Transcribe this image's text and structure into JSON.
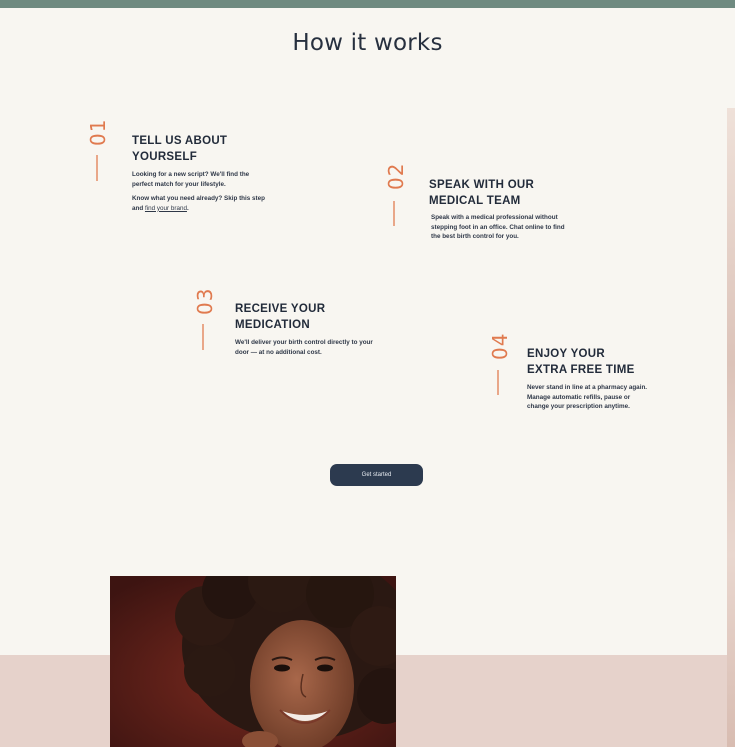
{
  "title": "How it works",
  "steps": [
    {
      "number": "01",
      "title": "TELL US ABOUT YOURSELF",
      "desc1": "Looking for a new script? We'll find the perfect match for your lifestyle.",
      "desc2_prefix": "Know what you need already? Skip this step and ",
      "desc2_link": "find your brand",
      "desc2_suffix": "."
    },
    {
      "number": "02",
      "title": "SPEAK WITH OUR MEDICAL TEAM",
      "desc1": "Speak with a medical professional without stepping foot in an office. Chat online to find the best birth control for you."
    },
    {
      "number": "03",
      "title": "RECEIVE YOUR MEDICATION",
      "desc1": "We'll deliver your birth control directly to your door — at no additional cost."
    },
    {
      "number": "04",
      "title": "ENJOY YOUR EXTRA FREE TIME",
      "desc1": "Never stand in line at a pharmacy again. Manage automatic refills, pause or change your prescription anytime."
    }
  ],
  "cta": {
    "label": "Get started"
  },
  "colors": {
    "accent": "#e07a4f",
    "button": "#2c3a4f",
    "topbar": "#6f8a80",
    "pink_band": "#e6d2cb",
    "background": "#f8f6f1"
  }
}
